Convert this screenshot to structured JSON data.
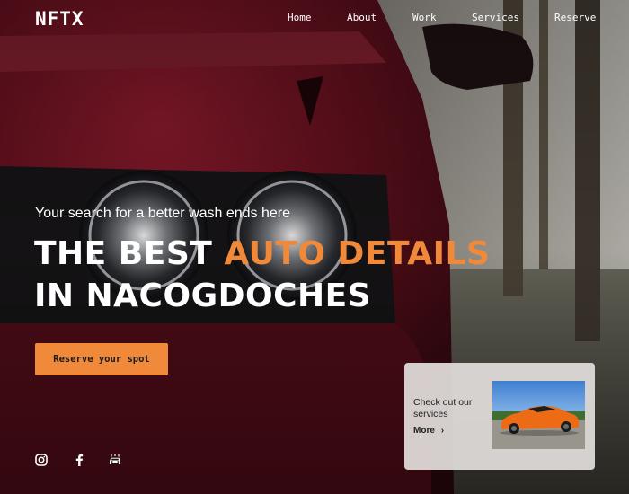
{
  "brand": {
    "logo": "NFTX"
  },
  "nav": {
    "items": [
      {
        "label": "Home"
      },
      {
        "label": "About"
      },
      {
        "label": "Work"
      },
      {
        "label": "Services"
      },
      {
        "label": "Reserve"
      }
    ]
  },
  "hero": {
    "tagline": "Your search for a better wash ends here",
    "headline_part1": "THE BEST ",
    "headline_accent": "AUTO DETAILS",
    "headline_part2": "IN NACOGDOCHES",
    "cta_label": "Reserve your spot"
  },
  "social": [
    {
      "icon": "instagram-icon"
    },
    {
      "icon": "facebook-icon"
    },
    {
      "icon": "car-wash-icon"
    }
  ],
  "services_card": {
    "text": "Check out our services",
    "more_label": "More",
    "more_arrow": "›",
    "thumbnail": "orange-sports-car-image"
  },
  "colors": {
    "accent": "#f08a3a",
    "text": "#ffffff",
    "card_bg": "#e2dedb"
  }
}
